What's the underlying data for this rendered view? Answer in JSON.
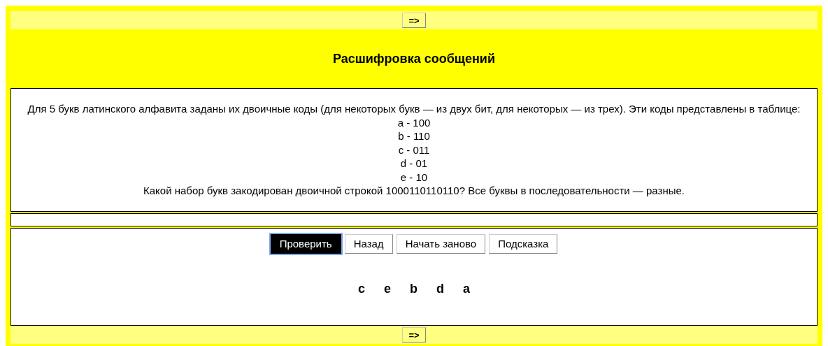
{
  "top_nav": {
    "label": "=>"
  },
  "title": "Расшифровка сообщений",
  "task": {
    "lines": [
      "Для 5 букв латинского алфавита заданы их двоичные коды (для некоторых букв — из двух бит, для некоторых — из трех). Эти коды представлены в таблице:",
      "a - 100",
      "b - 110",
      "c - 011",
      "d - 01",
      "e - 10",
      "Какой набор букв закодирован двоичной строкой 1000110110110? Все буквы в последовательности — разные."
    ]
  },
  "buttons": [
    {
      "label": "Проверить",
      "selected": true
    },
    {
      "label": "Назад",
      "selected": false
    },
    {
      "label": "Начать заново",
      "selected": false
    },
    {
      "label": "Подсказка",
      "selected": false
    }
  ],
  "answer": [
    "c",
    "e",
    "b",
    "d",
    "a"
  ],
  "bottom_nav": {
    "label": "=>"
  }
}
